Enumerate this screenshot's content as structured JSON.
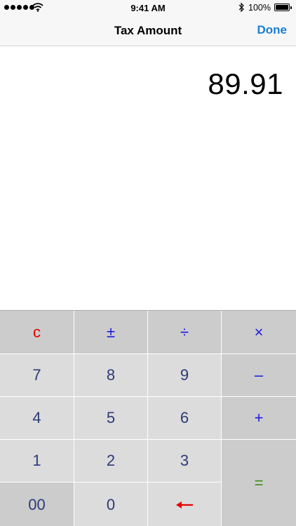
{
  "status_bar": {
    "time": "9:41 AM",
    "battery": "100%",
    "icons": [
      "signal-dots-icon",
      "wifi-icon",
      "bluetooth-icon",
      "battery-icon"
    ]
  },
  "nav": {
    "title": "Tax Amount",
    "done_label": "Done"
  },
  "display": {
    "value": "89.91"
  },
  "keypad": {
    "clear": "c",
    "plus_minus": "±",
    "divide": "÷",
    "multiply": "×",
    "seven": "7",
    "eight": "8",
    "nine": "9",
    "minus": "–",
    "four": "4",
    "five": "5",
    "six": "6",
    "plus": "+",
    "one": "1",
    "two": "2",
    "three": "3",
    "equals": "=",
    "double_zero": "00",
    "zero": "0",
    "backspace_icon": "left-arrow-icon"
  },
  "colors": {
    "accent": "#1a7fd4",
    "clear_key": "#e60000",
    "operator_key": "#1a1ae0",
    "equals_key": "#3e8a12",
    "digit_key": "#2c3a78"
  }
}
